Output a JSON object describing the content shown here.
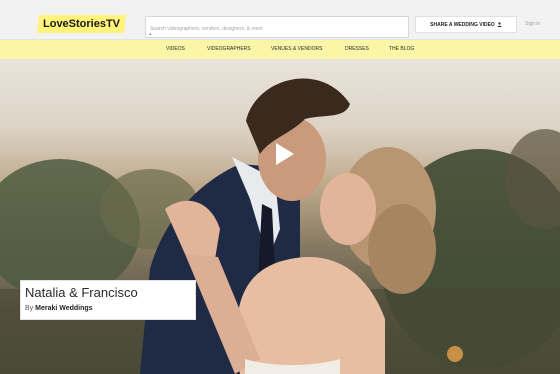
{
  "brand": {
    "logo_text": "LoveStoriesTV",
    "accent": "#fff37a"
  },
  "search": {
    "placeholder": "Search videographers, vendors, designers, & more"
  },
  "header": {
    "share_label": "SHARE A WEDDING VIDEO",
    "share_icon": "user-icon",
    "signin_label": "Sign in"
  },
  "nav": {
    "items": [
      {
        "label": "VIDEOS"
      },
      {
        "label": "VIDEOGRAPHERS"
      },
      {
        "label": "VENUES & VENDORS"
      },
      {
        "label": "DRESSES"
      },
      {
        "label": "THE BLOG"
      }
    ],
    "background": "#fbf6a7"
  },
  "hero": {
    "play_icon": "play-icon",
    "title": "Natalia & Francisco",
    "by_prefix": "By",
    "vendor": "Meraki Weddings"
  }
}
